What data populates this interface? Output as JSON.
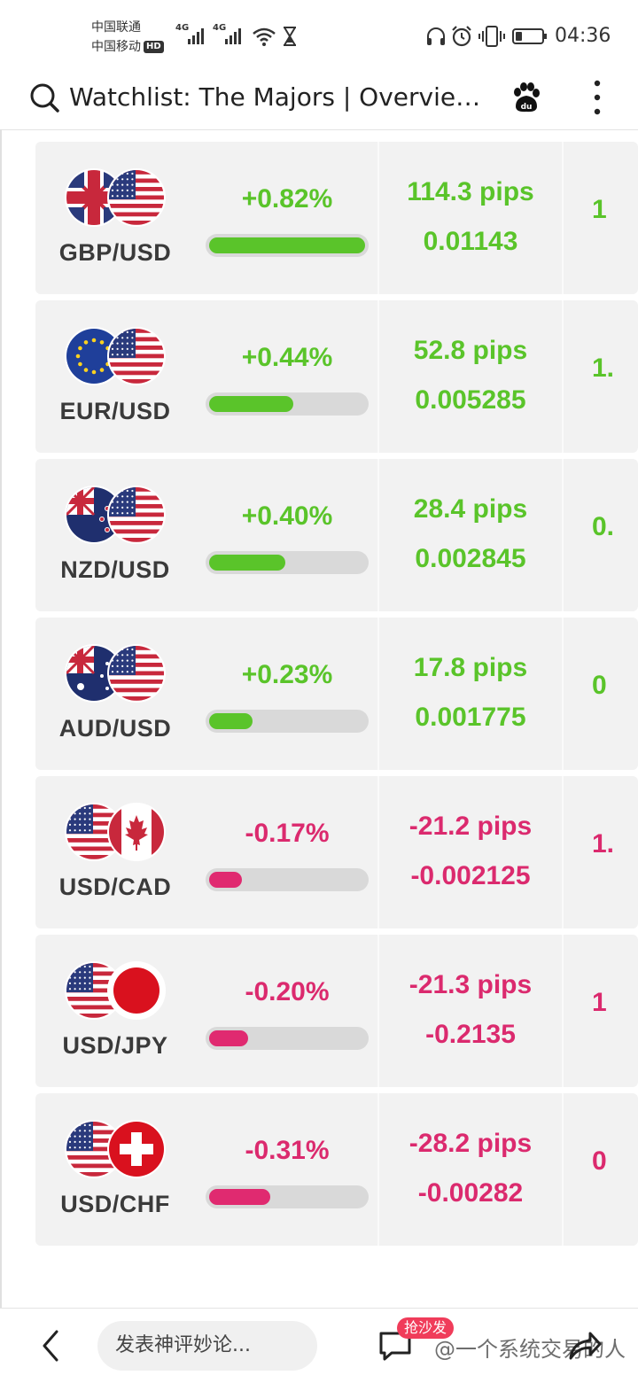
{
  "status_bar": {
    "carrier1": "中国联通",
    "carrier2": "中国移动",
    "hd": "HD",
    "signal1": "4G",
    "signal2": "4G",
    "battery_level": 0.25,
    "time": "04:36"
  },
  "header": {
    "title": "Watchlist: The Majors | Overvie…",
    "icons": [
      "search-icon",
      "baidu-paw-icon",
      "more-vertical-icon"
    ]
  },
  "rows": [
    {
      "pair": "GBP/USD",
      "flags": [
        "uk",
        "us"
      ],
      "change": "+0.82%",
      "direction": "up",
      "bar_fill": 1.0,
      "pips": "114.3 pips",
      "decimal": "0.01143",
      "clipped": "1"
    },
    {
      "pair": "EUR/USD",
      "flags": [
        "eu",
        "us"
      ],
      "change": "+0.44%",
      "direction": "up",
      "bar_fill": 0.54,
      "pips": "52.8 pips",
      "decimal": "0.005285",
      "clipped": "1."
    },
    {
      "pair": "NZD/USD",
      "flags": [
        "nz",
        "us"
      ],
      "change": "+0.40%",
      "direction": "up",
      "bar_fill": 0.49,
      "pips": "28.4 pips",
      "decimal": "0.002845",
      "clipped": "0."
    },
    {
      "pair": "AUD/USD",
      "flags": [
        "au",
        "us"
      ],
      "change": "+0.23%",
      "direction": "up",
      "bar_fill": 0.28,
      "pips": "17.8 pips",
      "decimal": "0.001775",
      "clipped": "0"
    },
    {
      "pair": "USD/CAD",
      "flags": [
        "us",
        "ca"
      ],
      "change": "-0.17%",
      "direction": "down",
      "bar_fill": 0.21,
      "pips": "-21.2 pips",
      "decimal": "-0.002125",
      "clipped": "1."
    },
    {
      "pair": "USD/JPY",
      "flags": [
        "us",
        "jp"
      ],
      "change": "-0.20%",
      "direction": "down",
      "bar_fill": 0.25,
      "pips": "-21.3 pips",
      "decimal": "-0.2135",
      "clipped": "1"
    },
    {
      "pair": "USD/CHF",
      "flags": [
        "us",
        "ch"
      ],
      "change": "-0.31%",
      "direction": "down",
      "bar_fill": 0.39,
      "pips": "-28.2 pips",
      "decimal": "-0.00282",
      "clipped": "0"
    }
  ],
  "colors": {
    "positive": "#5ac42a",
    "negative": "#db2a6e"
  },
  "bottom_bar": {
    "comment_placeholder": "发表神评妙论...",
    "badge": "抢沙发",
    "watermark": "@一个系统交易的人",
    "icons": [
      "back-icon",
      "comment-icon",
      "share-icon"
    ]
  }
}
